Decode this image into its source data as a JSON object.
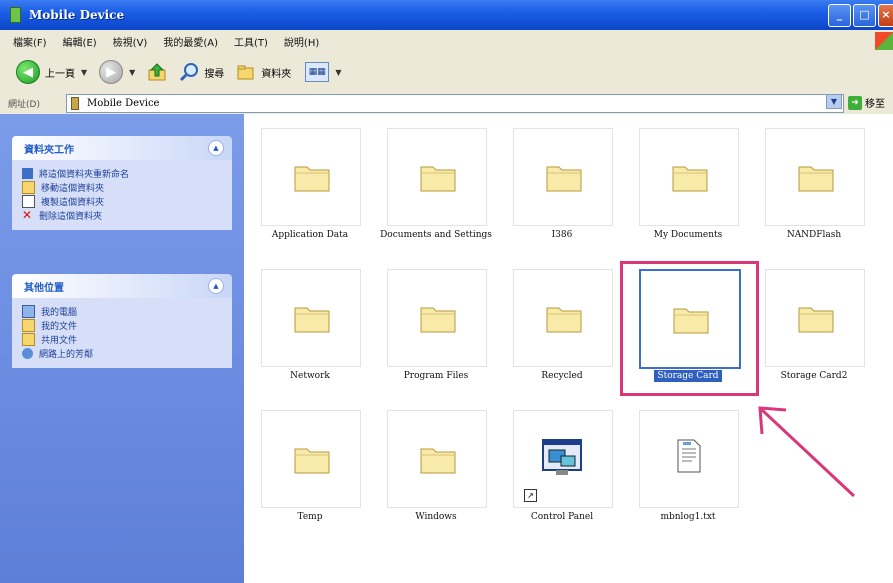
{
  "window": {
    "title": "Mobile Device"
  },
  "menu": {
    "items": [
      "檔案(F)",
      "編輯(E)",
      "檢視(V)",
      "我的最愛(A)",
      "工具(T)",
      "說明(H)"
    ]
  },
  "toolbar": {
    "back_label": "上一頁",
    "search_label": "搜尋",
    "folders_label": "資料夾"
  },
  "address": {
    "label": "網址(D)",
    "value": "Mobile Device",
    "go_label": "移至"
  },
  "left_pane": {
    "folder_tasks": {
      "title": "資料夾工作",
      "items": [
        {
          "label": "將這個資料夾重新命名",
          "icon": "rename-icon"
        },
        {
          "label": "移動這個資料夾",
          "icon": "move-icon"
        },
        {
          "label": "複製這個資料夾",
          "icon": "copy-icon"
        },
        {
          "label": "刪除這個資料夾",
          "icon": "delete-icon"
        }
      ]
    },
    "other_places": {
      "title": "其他位置",
      "items": [
        {
          "label": "我的電腦",
          "icon": "my-computer-icon"
        },
        {
          "label": "我的文件",
          "icon": "my-documents-icon"
        },
        {
          "label": "共用文件",
          "icon": "shared-documents-icon"
        },
        {
          "label": "網路上的芳鄰",
          "icon": "network-places-icon"
        }
      ]
    }
  },
  "content": {
    "items": [
      {
        "label": "Application Data",
        "type": "folder"
      },
      {
        "label": "Documents and Settings",
        "type": "folder"
      },
      {
        "label": "I386",
        "type": "folder"
      },
      {
        "label": "My Documents",
        "type": "folder"
      },
      {
        "label": "NANDFlash",
        "type": "folder"
      },
      {
        "label": "Network",
        "type": "folder"
      },
      {
        "label": "Program Files",
        "type": "folder"
      },
      {
        "label": "Recycled",
        "type": "folder"
      },
      {
        "label": "Storage Card",
        "type": "folder",
        "selected": true
      },
      {
        "label": "Storage Card2",
        "type": "folder"
      },
      {
        "label": "Temp",
        "type": "folder"
      },
      {
        "label": "Windows",
        "type": "folder"
      },
      {
        "label": "Control Panel",
        "type": "shortcut"
      },
      {
        "label": "mbnlog1.txt",
        "type": "text-file"
      }
    ]
  },
  "colors": {
    "title_bar": "#1c5ee6",
    "left_pane": "#6a8ae0",
    "highlight": "#d9377a",
    "selection": "#2f5fbf",
    "folder": "#f6e7a3"
  }
}
